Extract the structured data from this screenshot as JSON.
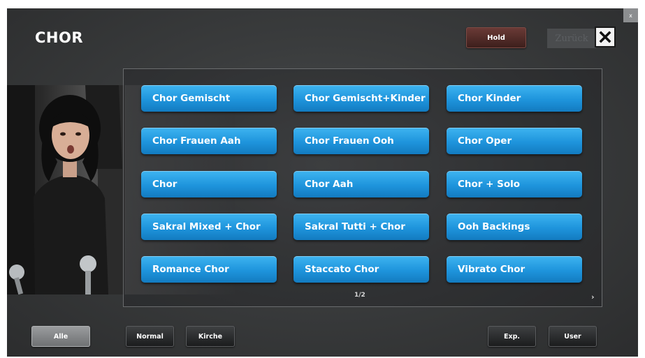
{
  "title": "CHOR",
  "header": {
    "hold_label": "Hold",
    "back_label": "Zurück"
  },
  "voices": [
    "Chor Gemischt",
    "Chor Gemischt+Kinder",
    "Chor Kinder",
    "Chor Frauen Aah",
    "Chor Frauen Ooh",
    "Chor Oper",
    "Chor",
    "Chor Aah",
    "Chor + Solo",
    "Sakral Mixed + Chor",
    "Sakral Tutti + Chor",
    "Ooh Backings",
    "Romance Chor",
    "Staccato Chor",
    "Vibrato Chor"
  ],
  "pager": "1/2",
  "filters": {
    "all": "Alle",
    "normal": "Normal",
    "church": "Kirche",
    "exp": "Exp.",
    "user": "User"
  },
  "icons": {
    "close": "close-icon",
    "corner_close": "close-icon",
    "next_page": "chevron-right-icon"
  },
  "colors": {
    "voice_button": "#1e94dc",
    "hold_button": "#5a302c",
    "selected_filter": "#8a8c8e",
    "background": "#3a3c3d"
  }
}
